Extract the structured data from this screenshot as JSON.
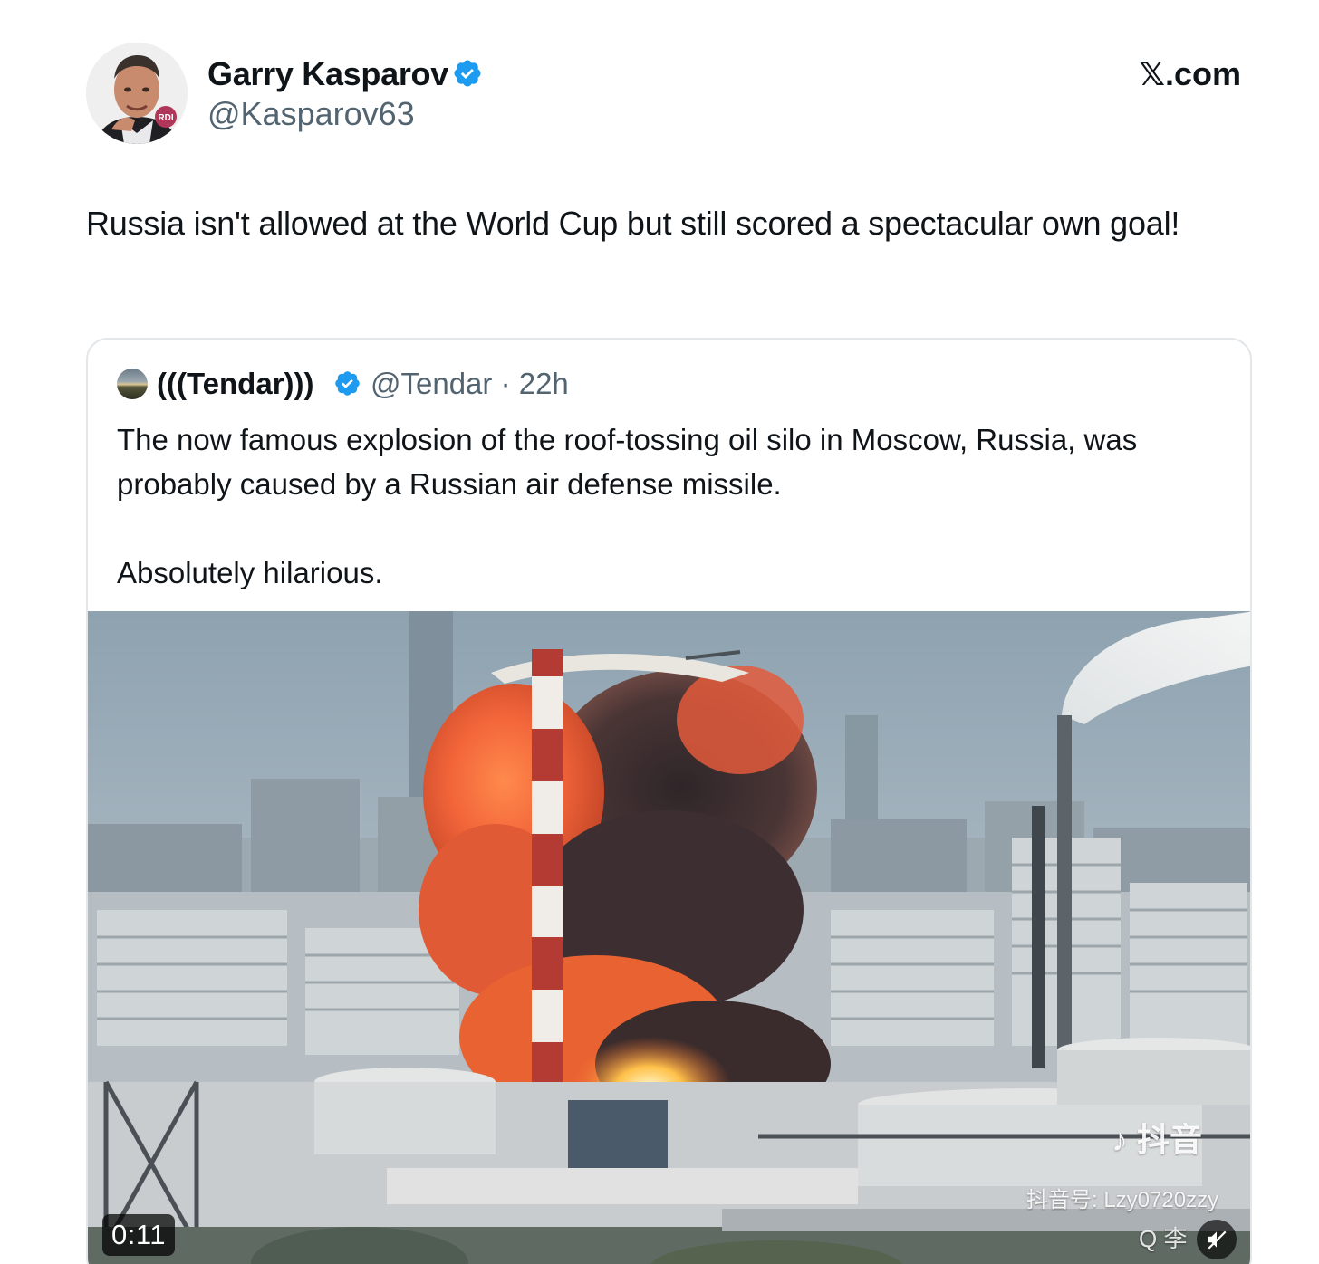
{
  "author": {
    "name": "Garry Kasparov",
    "handle": "@Kasparov63",
    "avatar_badge": "RDI"
  },
  "brand": "𝕏.com",
  "tweet": {
    "text": "Russia isn't allowed at the World Cup but still scored a spectacular own goal!"
  },
  "quote": {
    "name": "(((Tendar)))",
    "handle_time": "@Tendar · 22h",
    "text": "The now famous explosion of the roof-tossing oil silo in Moscow, Russia, was probably caused by a Russian air defense missile.\n\nAbsolutely hilarious."
  },
  "media": {
    "duration": "0:11",
    "watermark_logo": "抖音",
    "watermark_id": "抖音号: Lzy0720zzy",
    "watermark_search": "Q 李"
  },
  "colors": {
    "verified": "#1d9bf0",
    "text_primary": "#0f1419",
    "text_secondary": "#536471",
    "card_border": "#e3e7ea"
  },
  "icons": {
    "verified": "verified-badge-icon",
    "mute": "speaker-muted-icon",
    "watermark": "tiktok-note-icon"
  }
}
